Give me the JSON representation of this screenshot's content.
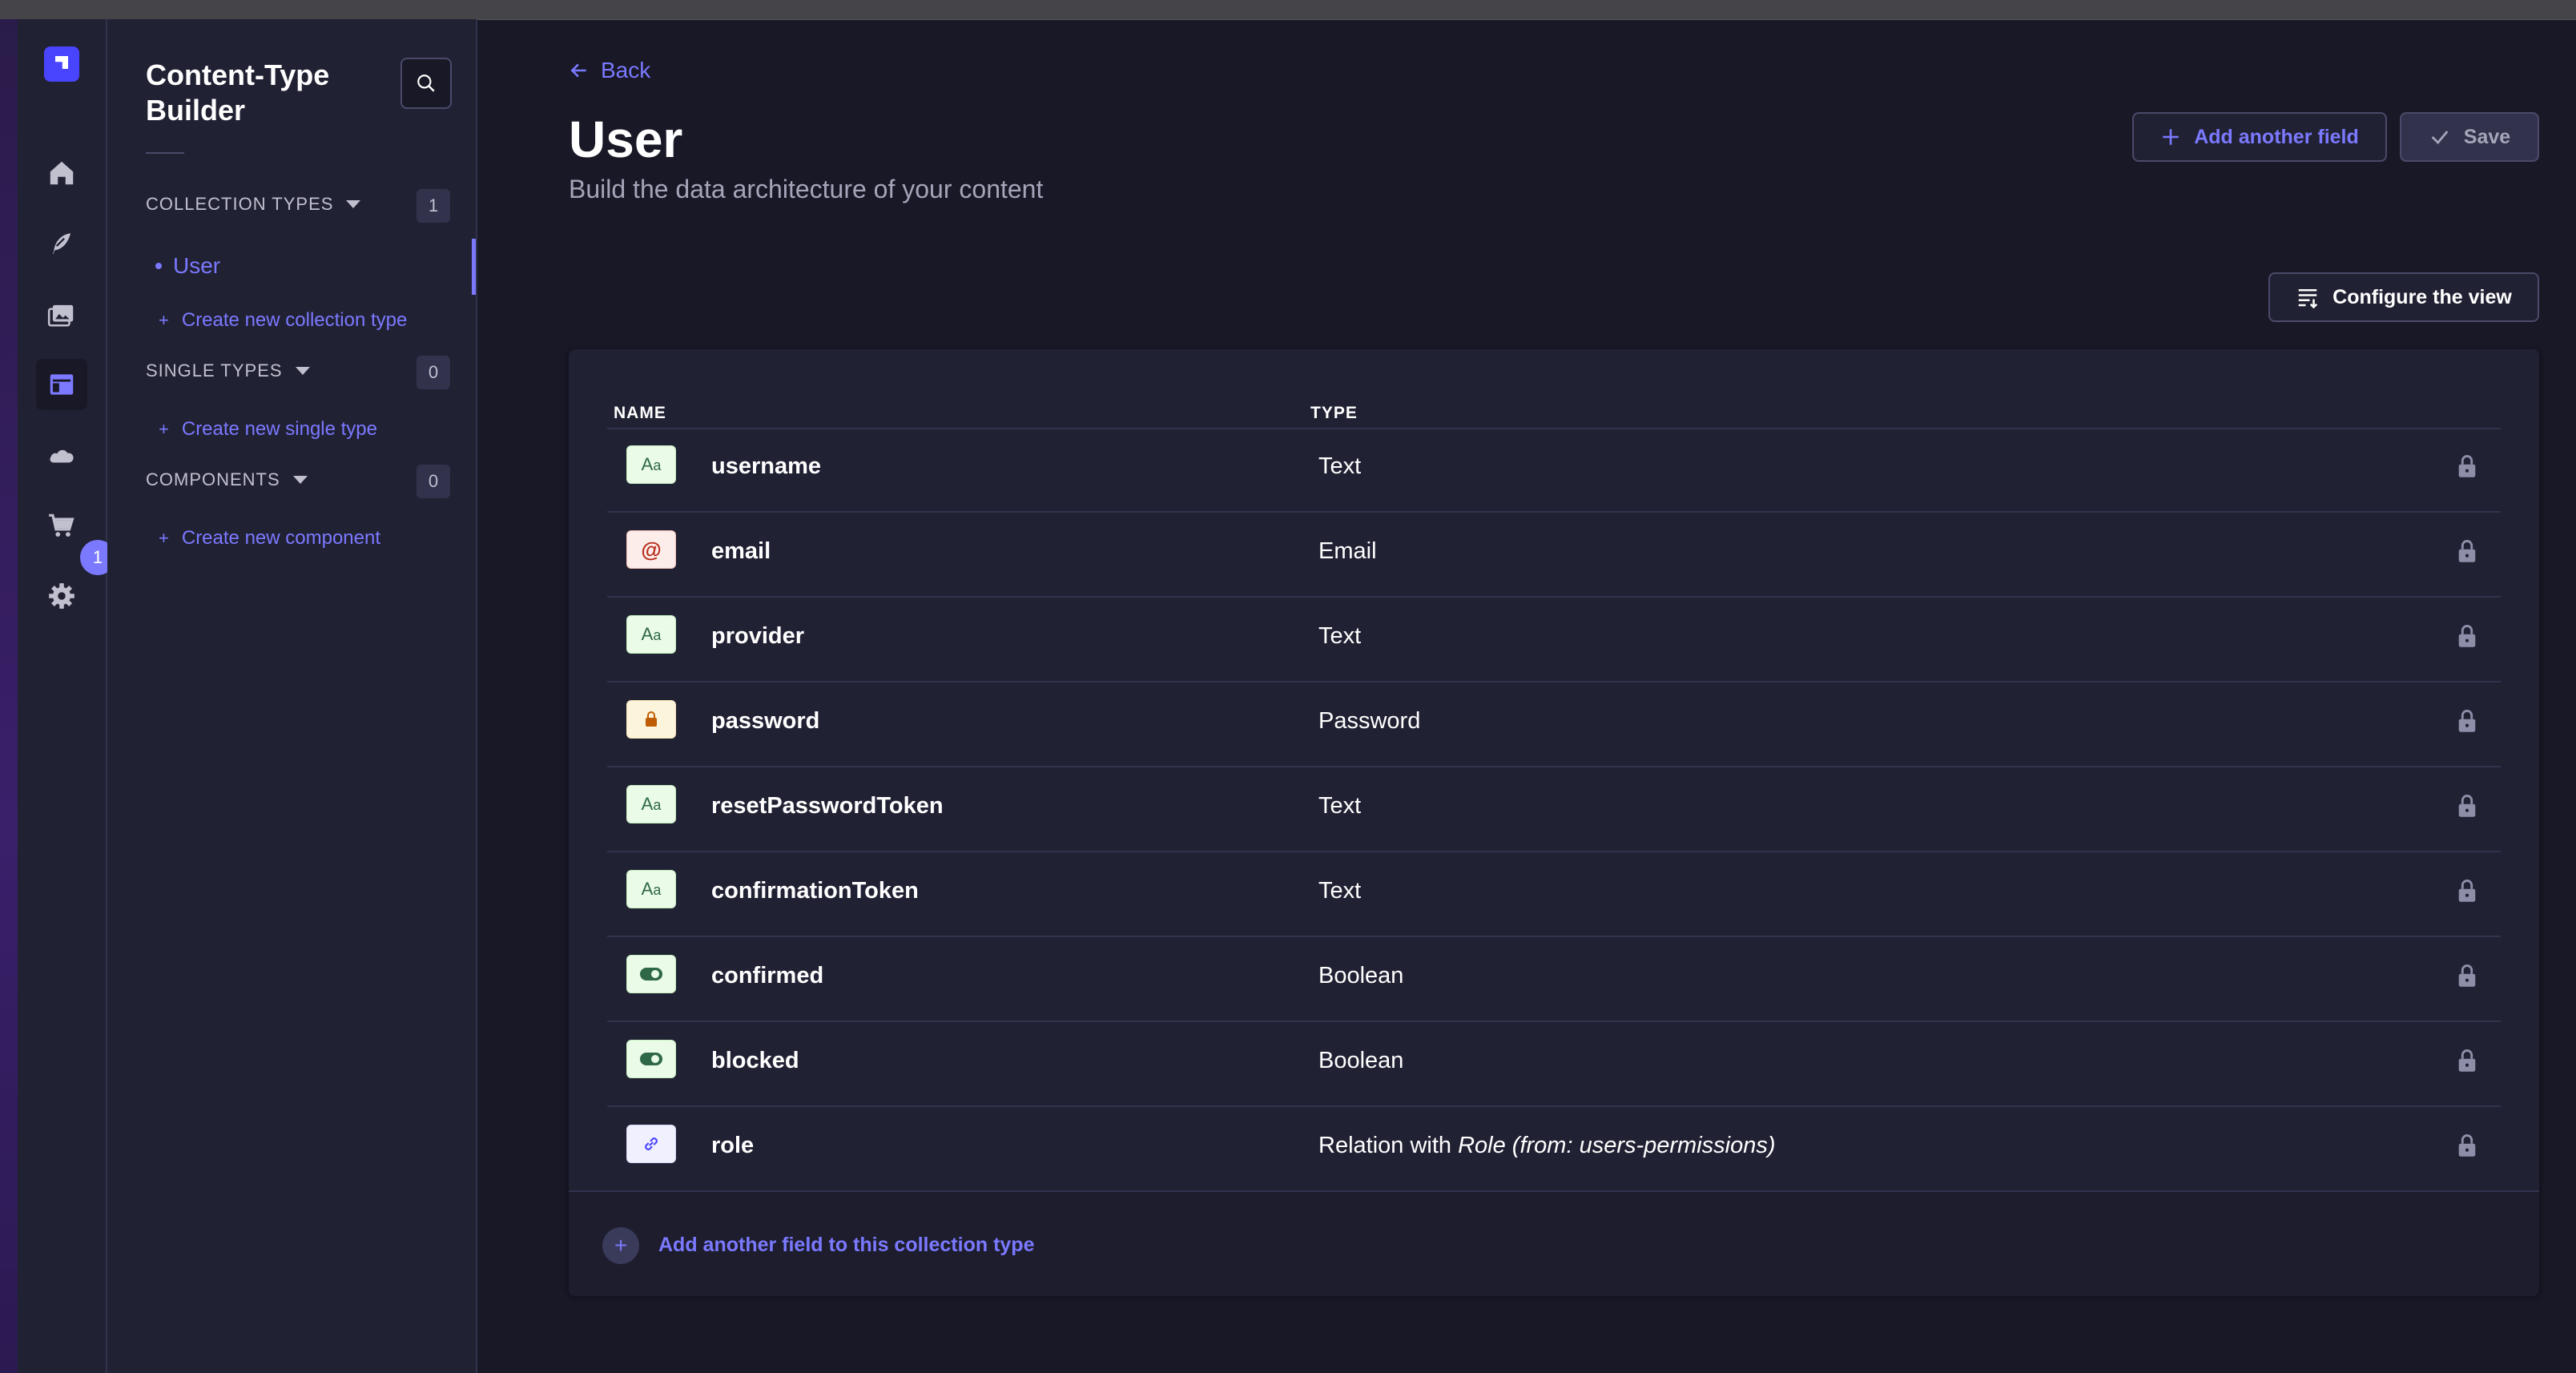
{
  "sidebar": {
    "title": "Content-Type Builder",
    "collection_types": {
      "label": "COLLECTION TYPES",
      "count": "1",
      "items": [
        "User"
      ],
      "create": "Create new collection type"
    },
    "single_types": {
      "label": "SINGLE TYPES",
      "count": "0",
      "create": "Create new single type"
    },
    "components": {
      "label": "COMPONENTS",
      "count": "0",
      "create": "Create new component"
    }
  },
  "rail": {
    "badge": "1"
  },
  "header": {
    "back": "Back",
    "title": "User",
    "subtitle": "Build the data architecture of your content",
    "add_field": "Add another field",
    "save": "Save",
    "configure": "Configure the view"
  },
  "table": {
    "col_name": "NAME",
    "col_type": "TYPE",
    "rows": [
      {
        "name": "username",
        "type": "Text",
        "icon": "text"
      },
      {
        "name": "email",
        "type": "Email",
        "icon": "email"
      },
      {
        "name": "provider",
        "type": "Text",
        "icon": "text"
      },
      {
        "name": "password",
        "type": "Password",
        "icon": "password"
      },
      {
        "name": "resetPasswordToken",
        "type": "Text",
        "icon": "text"
      },
      {
        "name": "confirmationToken",
        "type": "Text",
        "icon": "text"
      },
      {
        "name": "confirmed",
        "type": "Boolean",
        "icon": "boolean"
      },
      {
        "name": "blocked",
        "type": "Boolean",
        "icon": "boolean"
      },
      {
        "name": "role",
        "type": "Relation with ",
        "type_em": "Role (from: users-permissions)",
        "icon": "relation"
      }
    ],
    "footer_add": "Add another field to this collection type"
  },
  "colors": {
    "accent": "#7b79ff",
    "background": "#181826",
    "panel": "#212134",
    "border": "#32324d",
    "brand": "#4945ff"
  }
}
